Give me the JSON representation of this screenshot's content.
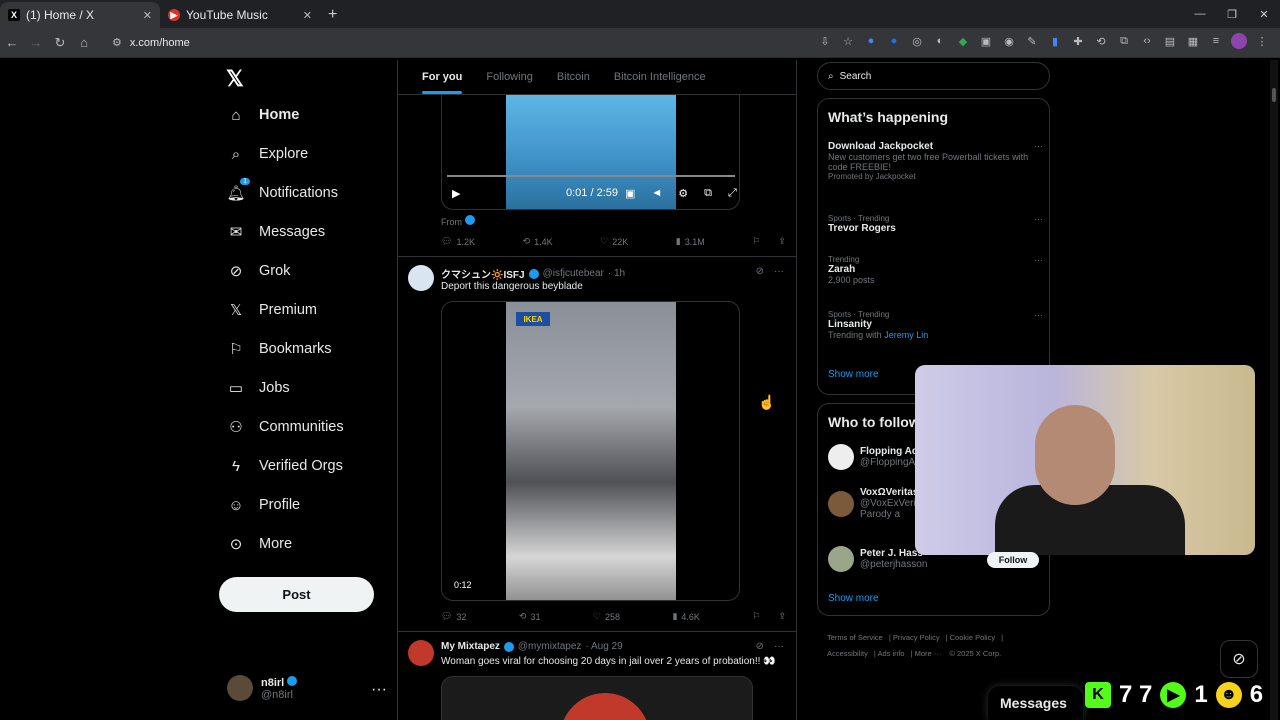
{
  "browser": {
    "tabs": [
      {
        "title": "(1) Home / X",
        "favicon": "X"
      },
      {
        "title": "YouTube Music",
        "favicon": "▶"
      }
    ],
    "new_tab": "+",
    "url": "x.com/home"
  },
  "nav": {
    "logo": "𝕏",
    "items": [
      {
        "label": "Home",
        "icon": "home-icon"
      },
      {
        "label": "Explore",
        "icon": "search-icon"
      },
      {
        "label": "Notifications",
        "icon": "bell-icon",
        "badge": "1"
      },
      {
        "label": "Messages",
        "icon": "envelope-icon"
      },
      {
        "label": "Grok",
        "icon": "grok-icon"
      },
      {
        "label": "Premium",
        "icon": "x-icon"
      },
      {
        "label": "Bookmarks",
        "icon": "bookmark-icon"
      },
      {
        "label": "Jobs",
        "icon": "briefcase-icon"
      },
      {
        "label": "Communities",
        "icon": "people-icon"
      },
      {
        "label": "Verified Orgs",
        "icon": "lightning-icon"
      },
      {
        "label": "Profile",
        "icon": "person-icon"
      },
      {
        "label": "More",
        "icon": "more-circle-icon"
      }
    ],
    "post_button": "Post",
    "account": {
      "name": "n8irl",
      "handle": "@n8irl"
    }
  },
  "feed": {
    "tabs": [
      "For you",
      "Following",
      "Bitcoin",
      "Bitcoin Intelligence"
    ],
    "post1": {
      "time": "0:01 / 2:59",
      "from": "From",
      "stats": {
        "replies": "1.2K",
        "reposts": "1.4K",
        "likes": "22K",
        "views": "3.1M"
      }
    },
    "post2": {
      "name": "クマシュン🔆ISFJ",
      "handle": "@isfjcutebear",
      "time": "· 1h",
      "text": "Deport this dangerous beyblade",
      "sign": "IKEA",
      "duration": "0:12",
      "stats": {
        "replies": "32",
        "reposts": "31",
        "likes": "258",
        "views": "4.6K"
      }
    },
    "post3": {
      "name": "My Mixtapez",
      "handle": "@mymixtapez",
      "time": "· Aug 29",
      "text": "Woman goes viral for choosing 20 days in jail over 2 years of probation!! 👀"
    }
  },
  "right": {
    "search_placeholder": "Search",
    "happening_title": "What’s happening",
    "trends": [
      {
        "category": "",
        "title": "Download Jackpocket",
        "subtitle": "New customers get two free Powerball tickets with code FREEBIE!",
        "promo": "Promoted by Jackpocket"
      },
      {
        "category": "Sports · Trending",
        "title": "Trevor Rogers",
        "subtitle": ""
      },
      {
        "category": "Trending",
        "title": "Zarah",
        "subtitle": "2,900 posts"
      },
      {
        "category": "Sports · Trending",
        "title": "Linsanity",
        "subtitle": "Trending with",
        "subtitle_link": "Jeremy Lin"
      }
    ],
    "show_more": "Show more",
    "who_to_follow_title": "Who to follow",
    "follow": [
      {
        "name": "Flopping Ac",
        "handle": "@FloppingA"
      },
      {
        "name": "VoxΩVeritas",
        "handle": "@VoxExVeri",
        "note": "Parody a"
      },
      {
        "name": "Peter J. Hass",
        "handle": "@peterjhasson"
      }
    ],
    "follow_button": "Follow",
    "footer": [
      "Terms of Service",
      "Privacy Policy",
      "Cookie Policy",
      "Accessibility",
      "Ads info",
      "More ···",
      "© 2025 X Corp."
    ]
  },
  "overlay": {
    "messages": "Messages",
    "stats": [
      "7 7",
      "1",
      "6"
    ]
  }
}
